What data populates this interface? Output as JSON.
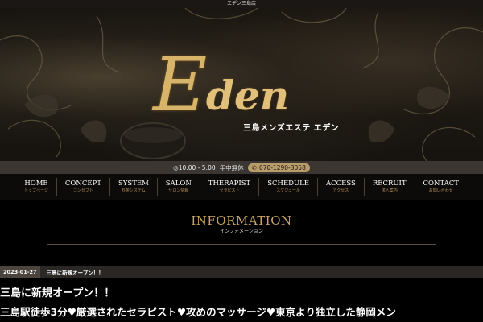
{
  "topbar": {
    "title": "エデン三島店"
  },
  "logo": {
    "initial": "E",
    "rest": "den",
    "subtitle": "三島メンズエステ エデン"
  },
  "infobar": {
    "hours": "◎10:00 - 5:00",
    "holiday": "年中無休",
    "phone": "070-1290-3058"
  },
  "nav": {
    "items": [
      {
        "en": "HOME",
        "ja": "トップページ"
      },
      {
        "en": "CONCEPT",
        "ja": "コンセプト"
      },
      {
        "en": "SYSTEM",
        "ja": "料金システム"
      },
      {
        "en": "SALON",
        "ja": "サロン情報"
      },
      {
        "en": "THERAPIST",
        "ja": "セラピスト"
      },
      {
        "en": "SCHEDULE",
        "ja": "スケジュール"
      },
      {
        "en": "ACCESS",
        "ja": "アクセス"
      },
      {
        "en": "RECRUIT",
        "ja": "求人案内"
      },
      {
        "en": "CONTACT",
        "ja": "お問い合わせ"
      }
    ]
  },
  "information": {
    "title": "INFORMATION",
    "subtitle": "インフォメーション"
  },
  "news": {
    "date": "2023-01-27",
    "title": "三島に新規オープン！！",
    "headline": "三島に新規オープン！！",
    "body": "三島駅徒歩3分♥厳選されたセラピスト♥攻めのマッサージ♥東京より独立した静岡メン"
  },
  "colors": {
    "gold": "#c9a461",
    "dark": "#000000",
    "pill": "#b89c6a"
  }
}
